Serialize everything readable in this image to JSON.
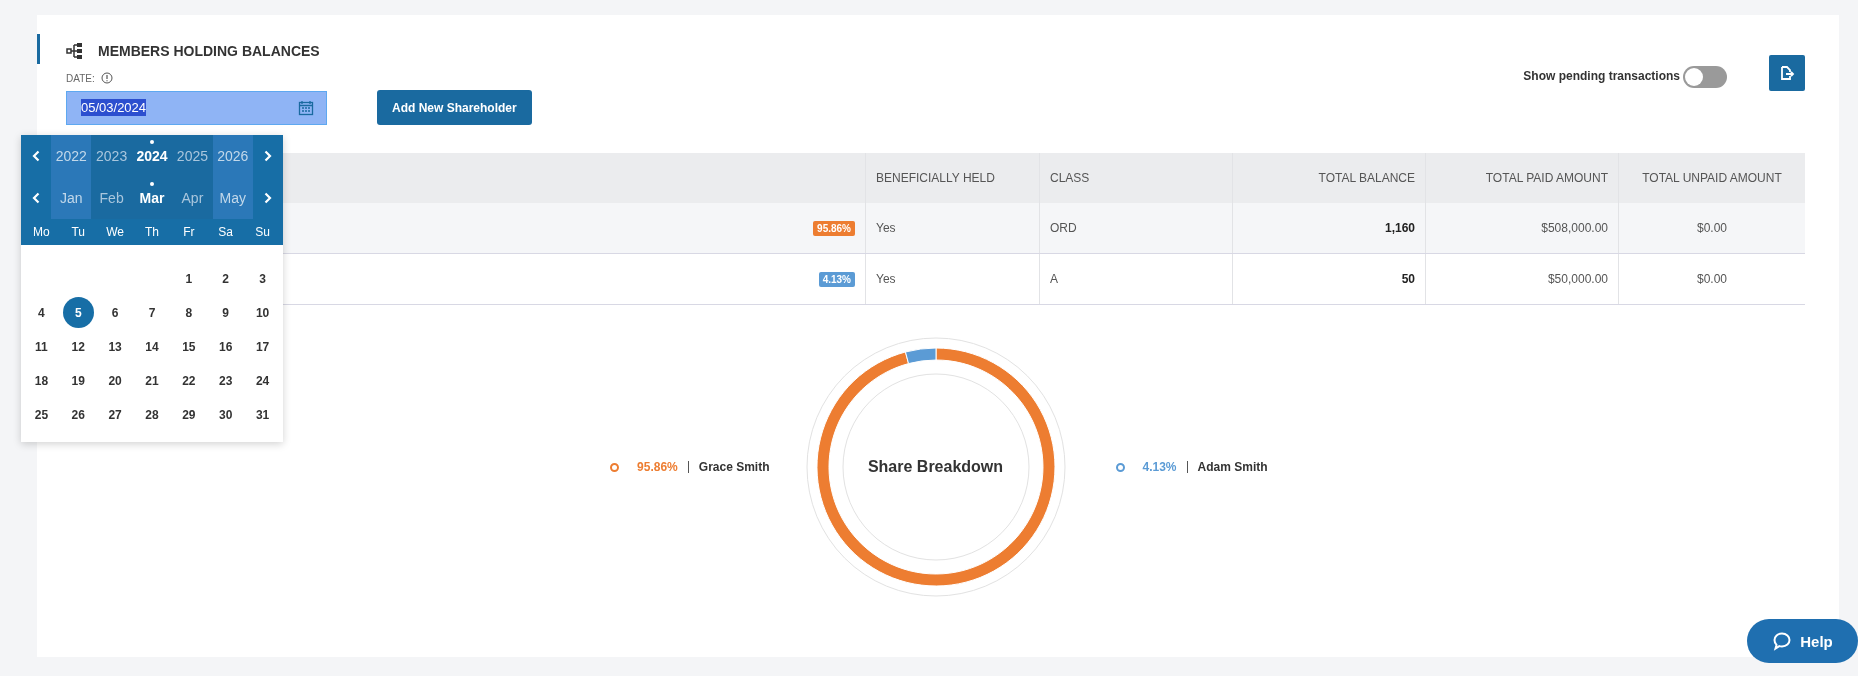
{
  "section": {
    "title": "MEMBERS HOLDING BALANCES"
  },
  "date_field": {
    "label": "DATE:",
    "value": "05/03/2024"
  },
  "add_button": {
    "label": "Add New Shareholder"
  },
  "pending_toggle": {
    "label": "Show pending transactions",
    "on": false
  },
  "datepicker": {
    "years": [
      {
        "label": "2022",
        "selected": false
      },
      {
        "label": "2023",
        "selected": false
      },
      {
        "label": "2024",
        "selected": true
      },
      {
        "label": "2025",
        "selected": false
      },
      {
        "label": "2026",
        "selected": false
      }
    ],
    "months": [
      {
        "label": "Jan",
        "selected": false
      },
      {
        "label": "Feb",
        "selected": false
      },
      {
        "label": "Mar",
        "selected": true
      },
      {
        "label": "Apr",
        "selected": false
      },
      {
        "label": "May",
        "selected": false
      }
    ],
    "weekdays": [
      "Mo",
      "Tu",
      "We",
      "Th",
      "Fr",
      "Sa",
      "Su"
    ],
    "weeks": [
      {
        "days": [
          {
            "label": "1",
            "selected": false
          },
          {
            "label": "2",
            "selected": false
          },
          {
            "label": "3",
            "selected": false
          }
        ]
      },
      {
        "days": [
          {
            "label": "4",
            "selected": false
          },
          {
            "label": "5",
            "selected": true
          },
          {
            "label": "6",
            "selected": false
          },
          {
            "label": "7",
            "selected": false
          },
          {
            "label": "8",
            "selected": false
          },
          {
            "label": "9",
            "selected": false
          },
          {
            "label": "10",
            "selected": false
          }
        ]
      },
      {
        "days": [
          {
            "label": "11",
            "selected": false
          },
          {
            "label": "12",
            "selected": false
          },
          {
            "label": "13",
            "selected": false
          },
          {
            "label": "14",
            "selected": false
          },
          {
            "label": "15",
            "selected": false
          },
          {
            "label": "16",
            "selected": false
          },
          {
            "label": "17",
            "selected": false
          }
        ]
      },
      {
        "days": [
          {
            "label": "18",
            "selected": false
          },
          {
            "label": "19",
            "selected": false
          },
          {
            "label": "20",
            "selected": false
          },
          {
            "label": "21",
            "selected": false
          },
          {
            "label": "22",
            "selected": false
          },
          {
            "label": "23",
            "selected": false
          },
          {
            "label": "24",
            "selected": false
          }
        ]
      },
      {
        "days": [
          {
            "label": "25",
            "selected": false
          },
          {
            "label": "26",
            "selected": false
          },
          {
            "label": "27",
            "selected": false
          },
          {
            "label": "28",
            "selected": false
          },
          {
            "label": "29",
            "selected": false
          },
          {
            "label": "30",
            "selected": false
          },
          {
            "label": "31",
            "selected": false
          }
        ]
      }
    ]
  },
  "table": {
    "columns": [
      "BENEFICIALLY HELD",
      "CLASS",
      "TOTAL BALANCE",
      "TOTAL PAID AMOUNT",
      "TOTAL UNPAID AMOUNT"
    ],
    "rows": [
      {
        "share_badge": "95.86%",
        "color": "#ed7d31",
        "beneficially_held": "Yes",
        "class": "ORD",
        "total_balance": "1,160",
        "total_paid": "$508,000.00",
        "total_unpaid": "$0.00"
      },
      {
        "share_badge": "4.13%",
        "color": "#5b9bd5",
        "beneficially_held": "Yes",
        "class": "A",
        "total_balance": "50",
        "total_paid": "$50,000.00",
        "total_unpaid": "$0.00"
      }
    ]
  },
  "share_chart": {
    "chart_data": {
      "type": "donut",
      "title": "Share Breakdown",
      "categories": [
        "Grace Smith",
        "Adam Smith"
      ],
      "values": [
        95.86,
        4.13
      ]
    },
    "legend": [
      {
        "percent": "95.86%",
        "color": "#ed7d31"
      },
      {
        "percent": "4.13%",
        "color": "#5b9bd5"
      }
    ]
  },
  "help_button": {
    "label": "Help"
  }
}
